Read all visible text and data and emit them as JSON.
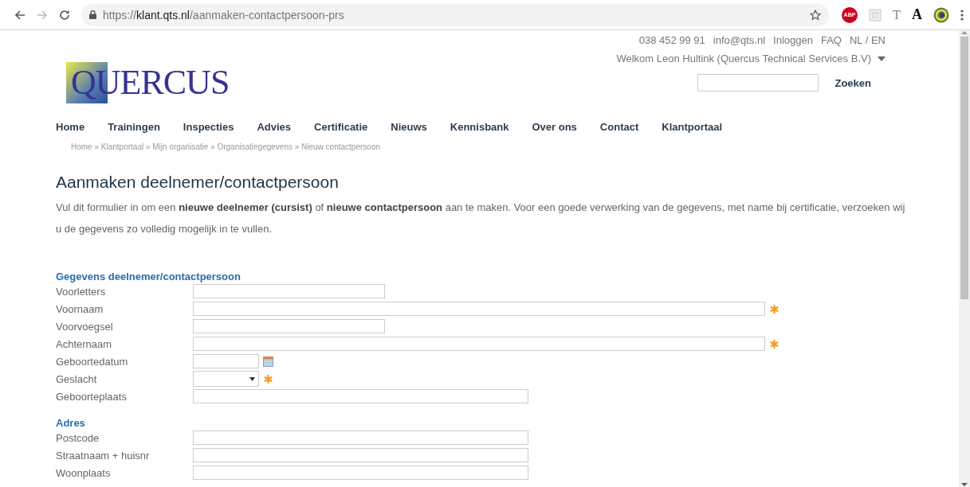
{
  "browser": {
    "url": "https://**klant.qts.nl**/aanmaken-contactpersoon-prs",
    "extensions": [
      {
        "kind": "badge",
        "glyph": "ABP"
      },
      {
        "kind": "square"
      },
      {
        "kind": "letter",
        "glyph": "T"
      },
      {
        "kind": "serif",
        "glyph": "A"
      },
      {
        "kind": "profile"
      }
    ]
  },
  "header": {
    "logo": "QUERCUS",
    "contact_links": [
      "038 452 99 91",
      "info@qts.nl",
      "Inloggen",
      "FAQ",
      "NL / EN"
    ],
    "welcome": "Welkom Leon Hultink (Quercus Technical Services B.V)",
    "search_button": "Zoeken"
  },
  "nav": [
    "Home",
    "Trainingen",
    "Inspecties",
    "Advies",
    "Certificatie",
    "Nieuws",
    "Kennisbank",
    "Over ons",
    "Contact",
    "Klantportaal"
  ],
  "breadcrumb": "Home » Klantportaal » Mijn organisatie » Organisatiegegevens » Nieuw contactpersoon",
  "title": "Aanmaken deelnemer/contactpersoon",
  "intro": "Vul dit formulier in om een **nieuwe deelnemer (cursist)** of **nieuwe contactpersoon** aan te maken. Voor een goede verwerking van de gegevens, met name bij certificatie, verzoeken wij u de gegevens zo volledig mogelijk in te vullen.",
  "sections": [
    {
      "heading": "Gegevens deelnemer/contactpersoon",
      "fields": [
        {
          "label": "Voorletters",
          "kind": "short",
          "required": false
        },
        {
          "label": "Voornaam",
          "kind": "long",
          "required": true
        },
        {
          "label": "Voorvoegsel",
          "kind": "short",
          "required": false
        },
        {
          "label": "Achternaam",
          "kind": "long",
          "required": true
        },
        {
          "label": "Geboortedatum",
          "kind": "date",
          "required": false
        },
        {
          "label": "Geslacht",
          "kind": "select",
          "required": true
        },
        {
          "label": "Geboorteplaats",
          "kind": "medium",
          "required": false
        }
      ]
    },
    {
      "heading": "Adres",
      "fields": [
        {
          "label": "Postcode",
          "kind": "medium",
          "required": false
        },
        {
          "label": "Straatnaam + huisnr",
          "kind": "medium",
          "required": false
        },
        {
          "label": "Woonplaats",
          "kind": "medium",
          "required": false
        }
      ]
    }
  ]
}
